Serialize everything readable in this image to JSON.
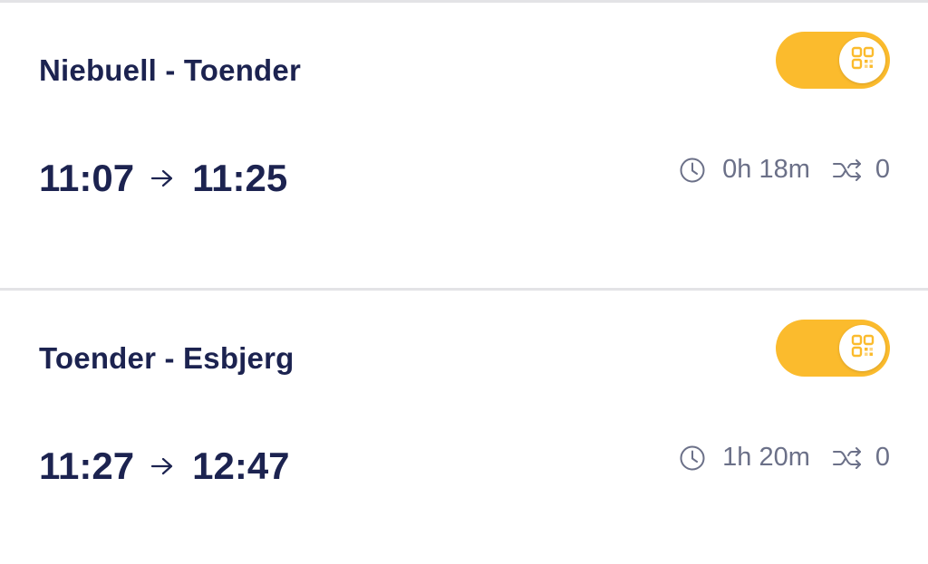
{
  "connections": [
    {
      "title": "Niebuell - Toender",
      "departure": "11:07",
      "arrival": "11:25",
      "duration": "0h 18m",
      "transfers": "0",
      "ticket_toggle": "on"
    },
    {
      "title": "Toender - Esbjerg",
      "departure": "11:27",
      "arrival": "12:47",
      "duration": "1h 20m",
      "transfers": "0",
      "ticket_toggle": "on"
    }
  ],
  "icons": {
    "toggle_knob": "qr-code-icon",
    "time_arrow": "arrow-right-icon",
    "duration": "clock-icon",
    "transfers": "shuffle-icon"
  },
  "colors": {
    "accent": "#fbbb2d",
    "title_text": "#1c2350",
    "meta_text": "#6b7088",
    "divider": "#e3e3e6",
    "background": "#ffffff"
  }
}
